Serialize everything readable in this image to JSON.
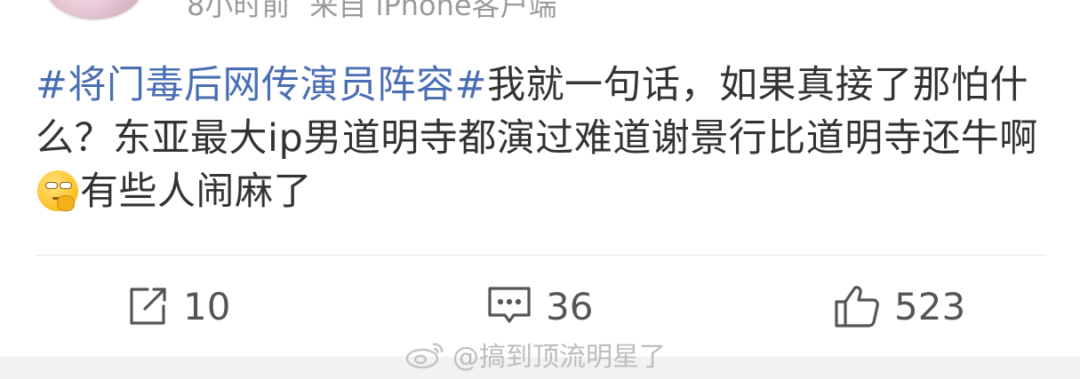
{
  "header": {
    "time": "8小时前",
    "source": "来自 iPhone客户端"
  },
  "post": {
    "topic": "#将门毒后网传演员阵容#",
    "text_before_emoji": "我就一句话，如果真接了那怕什么？东亚最大ip男道明寺都演过难道谢景行比道明寺还牛啊",
    "emoji": "thinking-face-emoji",
    "text_after_emoji": "有些人闹麻了"
  },
  "actions": {
    "repost_count": "10",
    "comment_count": "36",
    "like_count": "523"
  },
  "watermark": {
    "text": "@搞到顶流明星了"
  },
  "colors": {
    "topic": "#4a6eb3",
    "text": "#333333",
    "meta": "#9a9a9a",
    "icon": "#555555"
  }
}
